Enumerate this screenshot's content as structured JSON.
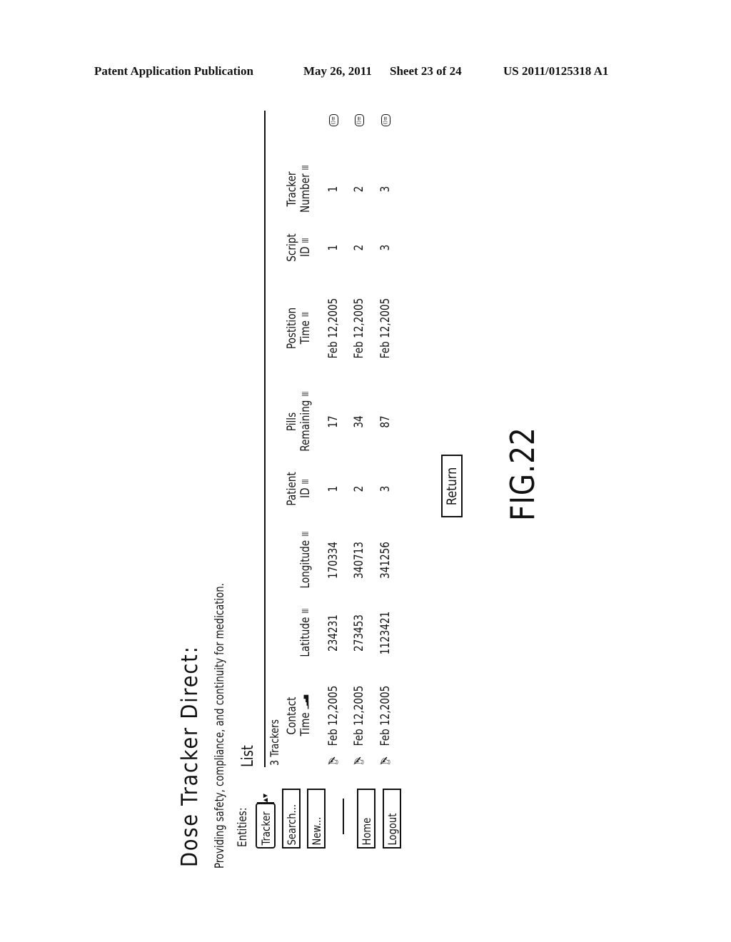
{
  "header": {
    "publication": "Patent Application Publication",
    "date": "May 26, 2011",
    "sheet": "Sheet 23 of 24",
    "number": "US 2011/0125318 A1"
  },
  "app": {
    "title": "Dose Tracker Direct:",
    "tagline": "Providing safety, compliance, and continuity for medication."
  },
  "sidebar": {
    "entities_label": "Entities:",
    "entity_select": {
      "value": "Tracker",
      "icon": "up-down-arrows-icon"
    },
    "buttons": {
      "search": "Search...",
      "new": "New...",
      "home": "Home",
      "logout": "Logout"
    }
  },
  "list": {
    "title": "List",
    "count": "3 Trackers",
    "sort_icon": "sort-bars-icon",
    "row_icon": "edit-pointer-icon",
    "record_icon": "record-details-icon",
    "columns": [
      {
        "line1": "Contact",
        "line2": "Time"
      },
      {
        "line1": "",
        "line2": "Latitude"
      },
      {
        "line1": "",
        "line2": "Longitude"
      },
      {
        "line1": "Patient",
        "line2": "ID"
      },
      {
        "line1": "Pills",
        "line2": "Remaining"
      },
      {
        "line1": "Postition",
        "line2": "Time"
      },
      {
        "line1": "Script",
        "line2": "ID"
      },
      {
        "line1": "Tracker",
        "line2": "Number"
      }
    ],
    "rows": [
      [
        "Feb 12,2005",
        "234231",
        "170334",
        "1",
        "17",
        "Feb 12,2005",
        "1",
        "1"
      ],
      [
        "Feb 12,2005",
        "273453",
        "340713",
        "2",
        "34",
        "Feb 12,2005",
        "2",
        "2"
      ],
      [
        "Feb 12,2005",
        "1123421",
        "341256",
        "3",
        "87",
        "Feb 12,2005",
        "3",
        "3"
      ]
    ]
  },
  "actions": {
    "return": "Return"
  },
  "figure_label": "FIG.22"
}
